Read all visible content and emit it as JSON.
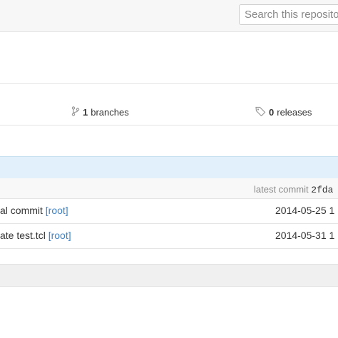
{
  "search": {
    "placeholder": "Search this reposito"
  },
  "stats": {
    "branches": {
      "count": "1",
      "label": "branches"
    },
    "releases": {
      "count": "0",
      "label": "releases"
    }
  },
  "latest_commit": {
    "label": "latest commit",
    "sha": "2fda"
  },
  "files": [
    {
      "message": "al commit",
      "tag": "[root]",
      "date": "2014-05-25 1"
    },
    {
      "message": "ate test.tcl",
      "tag": "[root]",
      "date": "2014-05-31 1"
    }
  ]
}
